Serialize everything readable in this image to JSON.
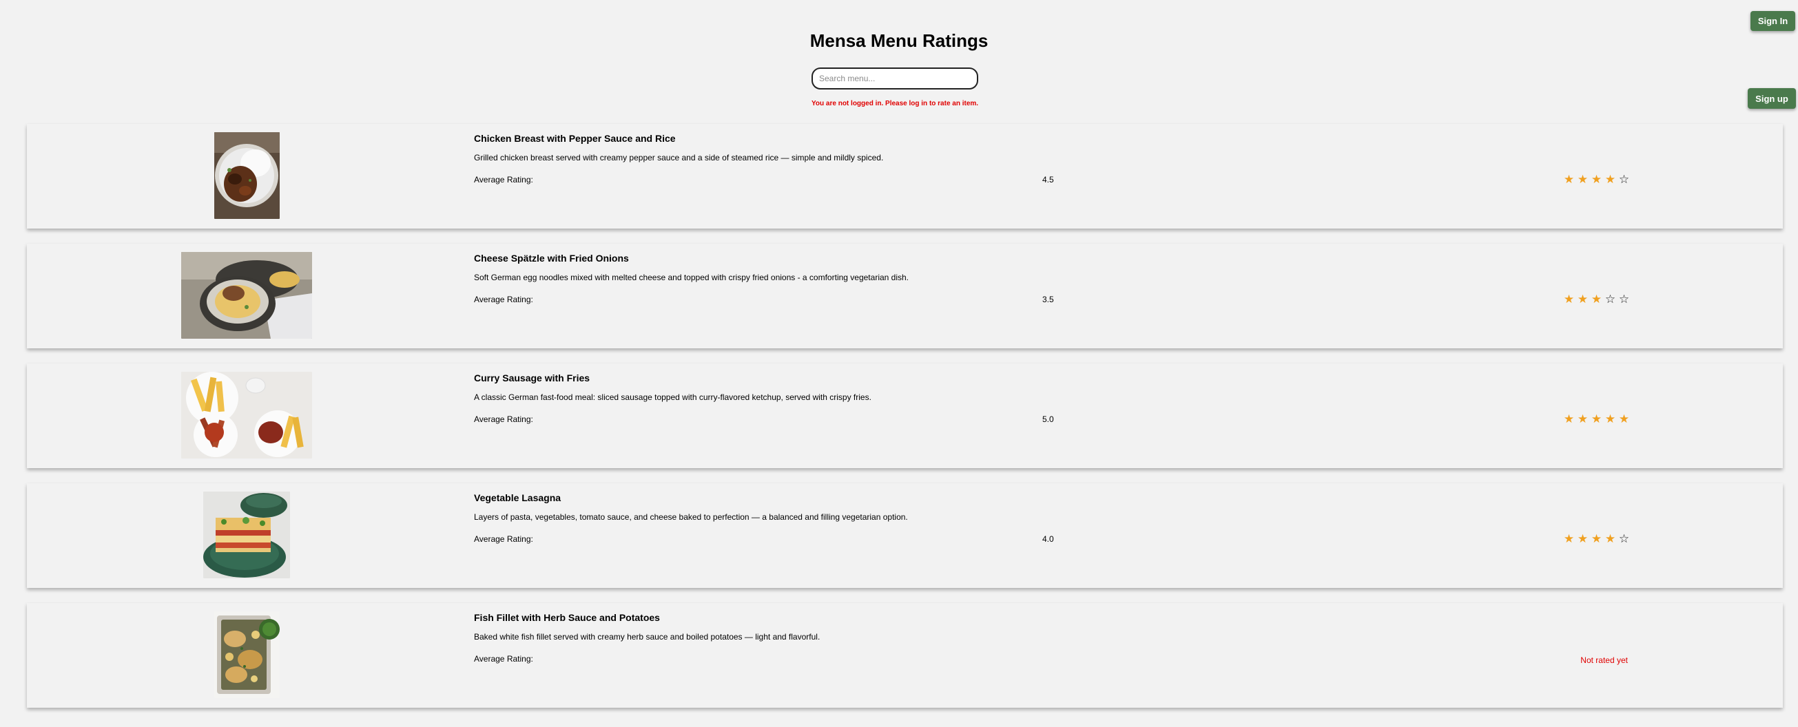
{
  "header": {
    "title": "Mensa Menu Ratings",
    "sign_in": "Sign In",
    "sign_up": "Sign up",
    "search_placeholder": "Search menu...",
    "login_warning": "You are not logged in. Please log in to rate an item."
  },
  "menu": [
    {
      "name": "Chicken Breast with Pepper Sauce and Rice",
      "description": "Grilled chicken breast served with creamy pepper sauce and a side of steamed rice — simple and mildly spiced.",
      "rating_label": "Average Rating:",
      "rating": "4.5",
      "stars": 4,
      "image": "chicken-rice-photo"
    },
    {
      "name": "Cheese Spätzle with Fried Onions",
      "description": "Soft German egg noodles mixed with melted cheese and topped with crispy fried onions - a comforting vegetarian dish.",
      "rating_label": "Average Rating:",
      "rating": "3.5",
      "stars": 3,
      "image": "spaetzle-photo"
    },
    {
      "name": "Curry Sausage with Fries",
      "description": "A classic German fast-food meal: sliced sausage topped with curry-flavored ketchup, served with crispy fries.",
      "rating_label": "Average Rating:",
      "rating": "5.0",
      "stars": 5,
      "image": "currywurst-photo"
    },
    {
      "name": "Vegetable Lasagna",
      "description": "Layers of pasta, vegetables, tomato sauce, and cheese baked to perfection — a balanced and filling vegetarian option.",
      "rating_label": "Average Rating:",
      "rating": "4.0",
      "stars": 4,
      "image": "lasagna-photo"
    },
    {
      "name": "Fish Fillet with Herb Sauce and Potatoes",
      "description": "Baked white fish fillet served with creamy herb sauce and boiled potatoes — light and flavorful.",
      "rating_label": "Average Rating:",
      "rating_status": "Not rated yet",
      "image": "fish-potatoes-photo"
    }
  ],
  "colors": {
    "button_green": "#4a7a4c",
    "star_gold": "#f0a020",
    "warning_red": "#e00000",
    "background": "#f2f2f2"
  }
}
